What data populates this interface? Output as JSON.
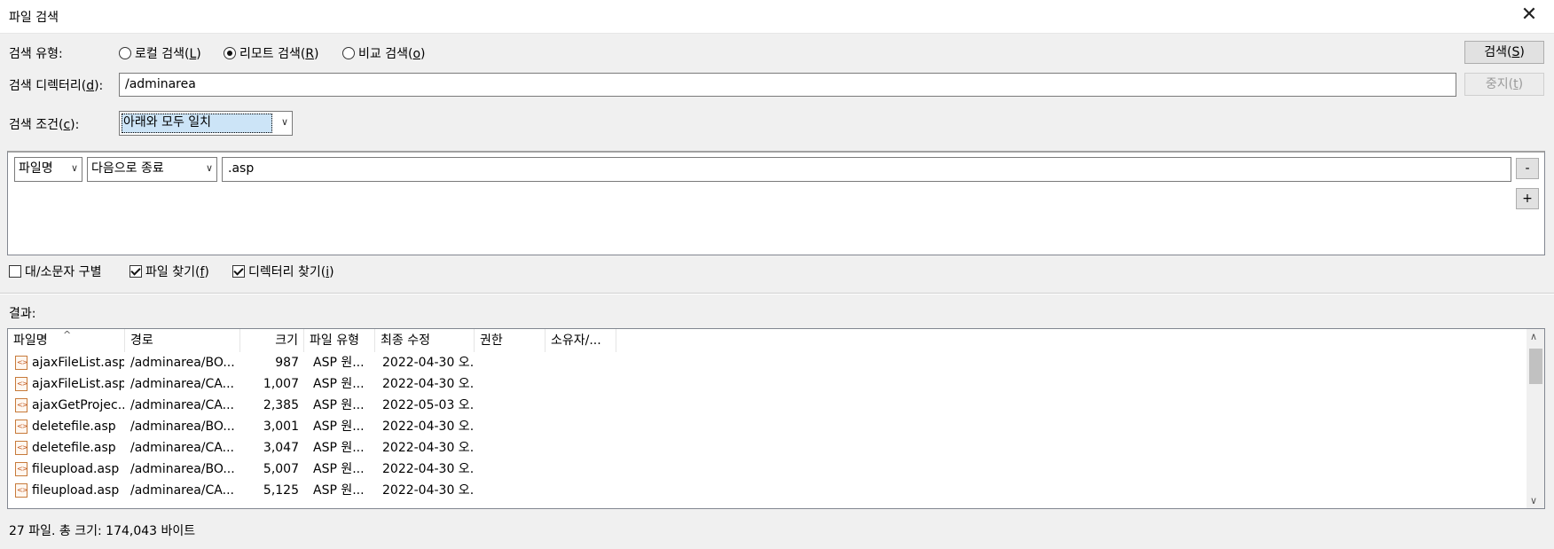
{
  "window": {
    "title": "파일 검색",
    "close_glyph": "✕"
  },
  "search_type": {
    "label": "검색 유형:",
    "options": [
      {
        "prefix": "로컬 검색(",
        "key": "L",
        "suffix": ")",
        "selected": false
      },
      {
        "prefix": "리모트 검색(",
        "key": "R",
        "suffix": ")",
        "selected": true
      },
      {
        "prefix": "비교 검색(",
        "key": "o",
        "suffix": ")",
        "selected": false
      }
    ]
  },
  "search_dir": {
    "label_prefix": "검색 디렉터리(",
    "label_key": "d",
    "label_suffix": "):",
    "value": "/adminarea"
  },
  "search_cond": {
    "label_prefix": "검색 조건(",
    "label_key": "c",
    "label_suffix": "):",
    "value": "아래와 모두 일치"
  },
  "buttons": {
    "search": {
      "prefix": "검색(",
      "key": "S",
      "suffix": ")"
    },
    "stop": {
      "prefix": "중지(",
      "key": "t",
      "suffix": ")"
    }
  },
  "condition_row": {
    "field": "파일명",
    "operator": "다음으로 종료",
    "value": ".asp",
    "remove_label": "-",
    "add_label": "+"
  },
  "options": {
    "case_sensitive": {
      "label": "대/소문자 구별",
      "checked": false
    },
    "find_files": {
      "prefix": "파일 찾기(",
      "key": "f",
      "suffix": ")",
      "checked": true
    },
    "find_dirs": {
      "prefix": "디렉터리 찾기(",
      "key": "i",
      "suffix": ")",
      "checked": true
    }
  },
  "results": {
    "label": "결과:",
    "columns": [
      "파일명",
      "경로",
      "크기",
      "파일 유형",
      "최종 수정",
      "권한",
      "소유자/..."
    ],
    "sort_icon": "^",
    "rows": [
      {
        "name": "ajaxFileList.asp",
        "path": "/adminarea/BO...",
        "size": "987",
        "type": "ASP 원...",
        "modified": "2022-04-30 오..."
      },
      {
        "name": "ajaxFileList.asp",
        "path": "/adminarea/CA...",
        "size": "1,007",
        "type": "ASP 원...",
        "modified": "2022-04-30 오..."
      },
      {
        "name": "ajaxGetProjec...",
        "path": "/adminarea/CA...",
        "size": "2,385",
        "type": "ASP 원...",
        "modified": "2022-05-03 오..."
      },
      {
        "name": "deletefile.asp",
        "path": "/adminarea/BO...",
        "size": "3,001",
        "type": "ASP 원...",
        "modified": "2022-04-30 오..."
      },
      {
        "name": "deletefile.asp",
        "path": "/adminarea/CA...",
        "size": "3,047",
        "type": "ASP 원...",
        "modified": "2022-04-30 오..."
      },
      {
        "name": "fileupload.asp",
        "path": "/adminarea/BO...",
        "size": "5,007",
        "type": "ASP 원...",
        "modified": "2022-04-30 오..."
      },
      {
        "name": "fileupload.asp",
        "path": "/adminarea/CA...",
        "size": "5,125",
        "type": "ASP 원...",
        "modified": "2022-04-30 오..."
      }
    ]
  },
  "status": "27 파일. 총 크기: 174,043 바이트"
}
